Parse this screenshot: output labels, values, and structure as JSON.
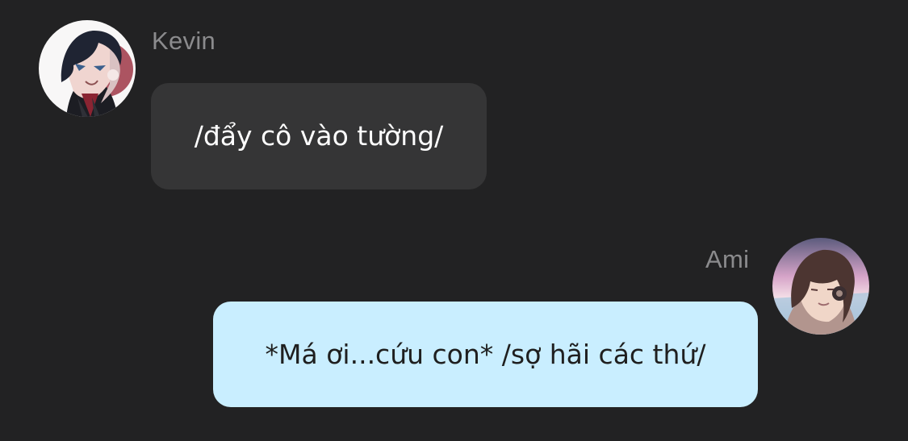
{
  "chat": {
    "messages": [
      {
        "sender": "Kevin",
        "text": "/đẩy cô vào tường/",
        "direction": "incoming",
        "avatar_icon": "anime-boy-avatar-icon"
      },
      {
        "sender": "Ami",
        "text": "*Má ơi...cứu con* /sợ hãi các thứ/",
        "direction": "outgoing",
        "avatar_icon": "anime-girl-avatar-icon"
      }
    ]
  },
  "colors": {
    "background": "#222223",
    "incoming_bubble": "#353536",
    "outgoing_bubble": "#c9eeff",
    "sender_name": "#8b8b8d"
  }
}
